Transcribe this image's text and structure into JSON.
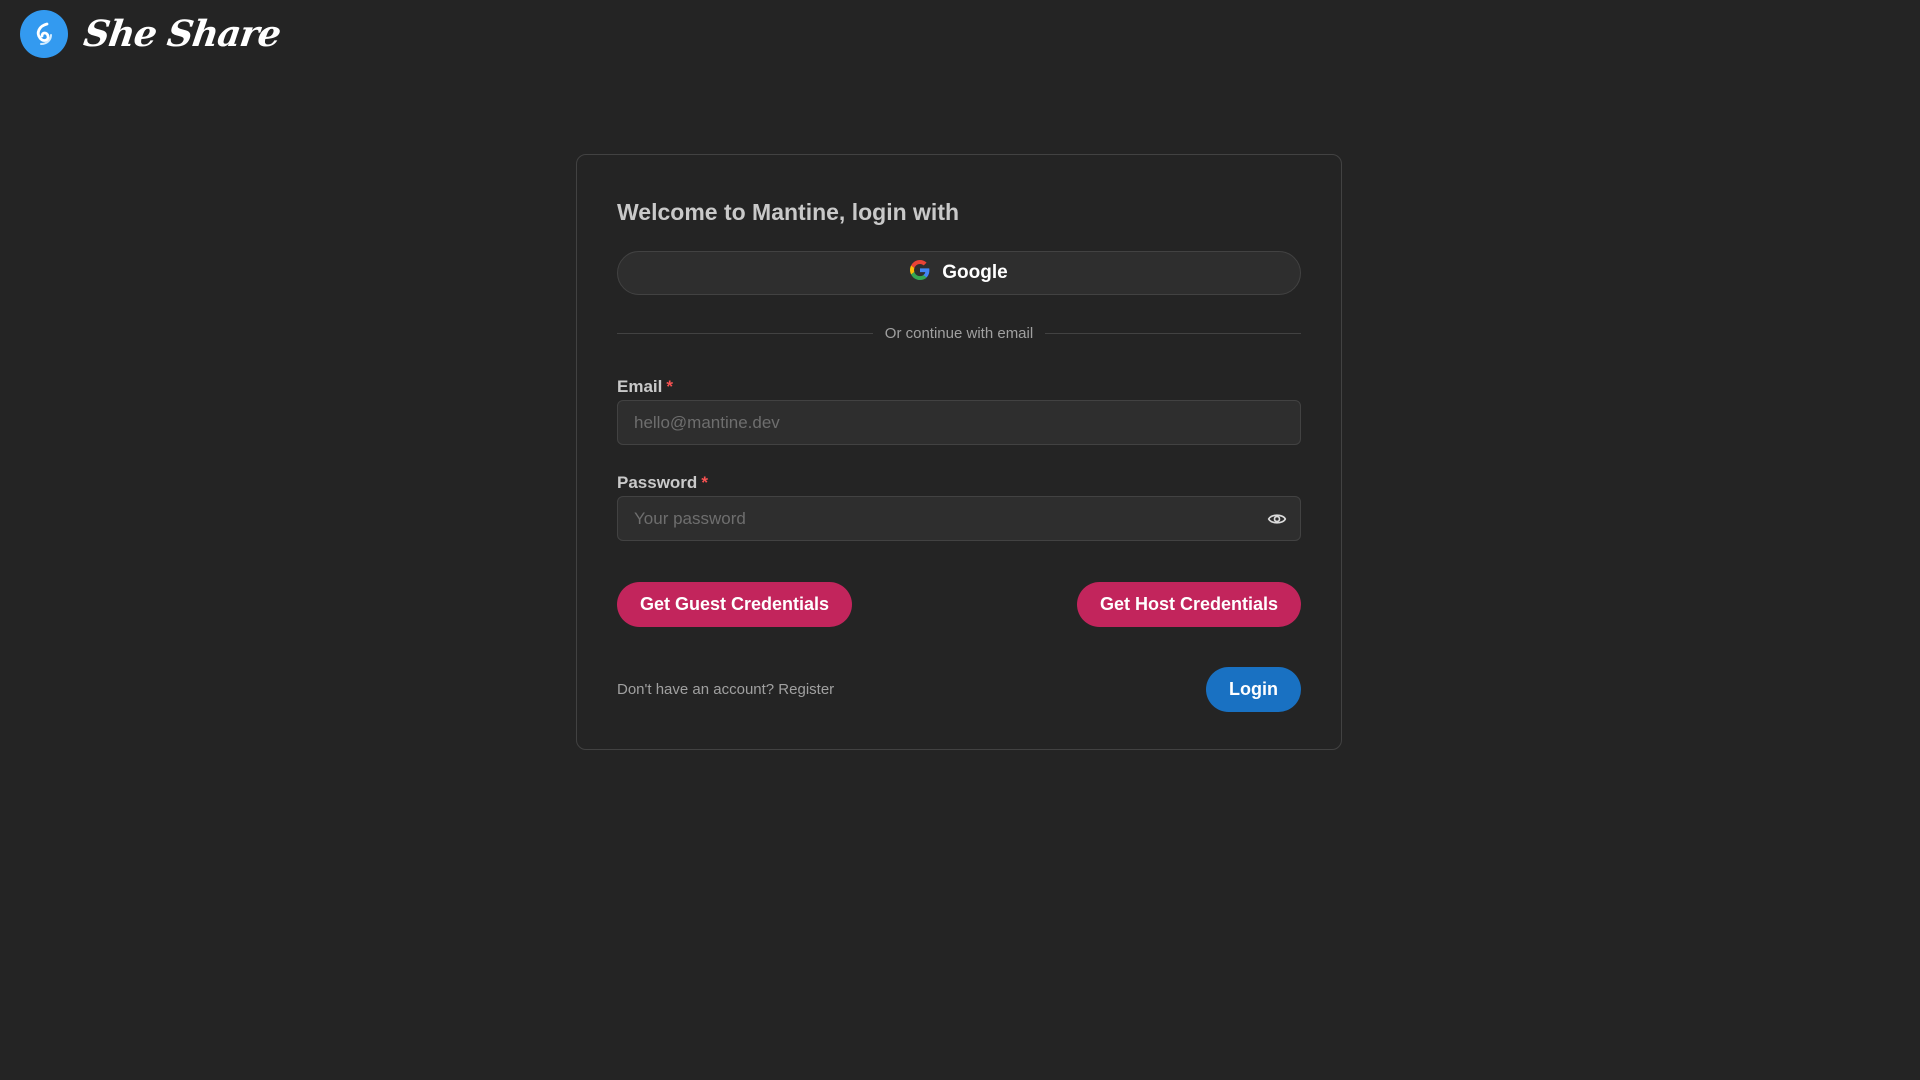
{
  "header": {
    "brand": "She Share",
    "logo_color": "#339af0"
  },
  "login": {
    "title": "Welcome to Mantine, login with",
    "google_label": "Google",
    "divider_text": "Or continue with email",
    "email": {
      "label": "Email",
      "required_mark": "*",
      "placeholder": "hello@mantine.dev",
      "value": ""
    },
    "password": {
      "label": "Password",
      "required_mark": "*",
      "placeholder": "Your password",
      "value": "",
      "toggle_icon": "eye-icon"
    },
    "guest_button": "Get Guest Credentials",
    "host_button": "Get Host Credentials",
    "register_text": "Don't have an account? Register",
    "login_button": "Login"
  },
  "colors": {
    "background": "#242424",
    "accent_pink": "#c2255c",
    "accent_blue": "#1971c2",
    "required": "#fa5252"
  }
}
